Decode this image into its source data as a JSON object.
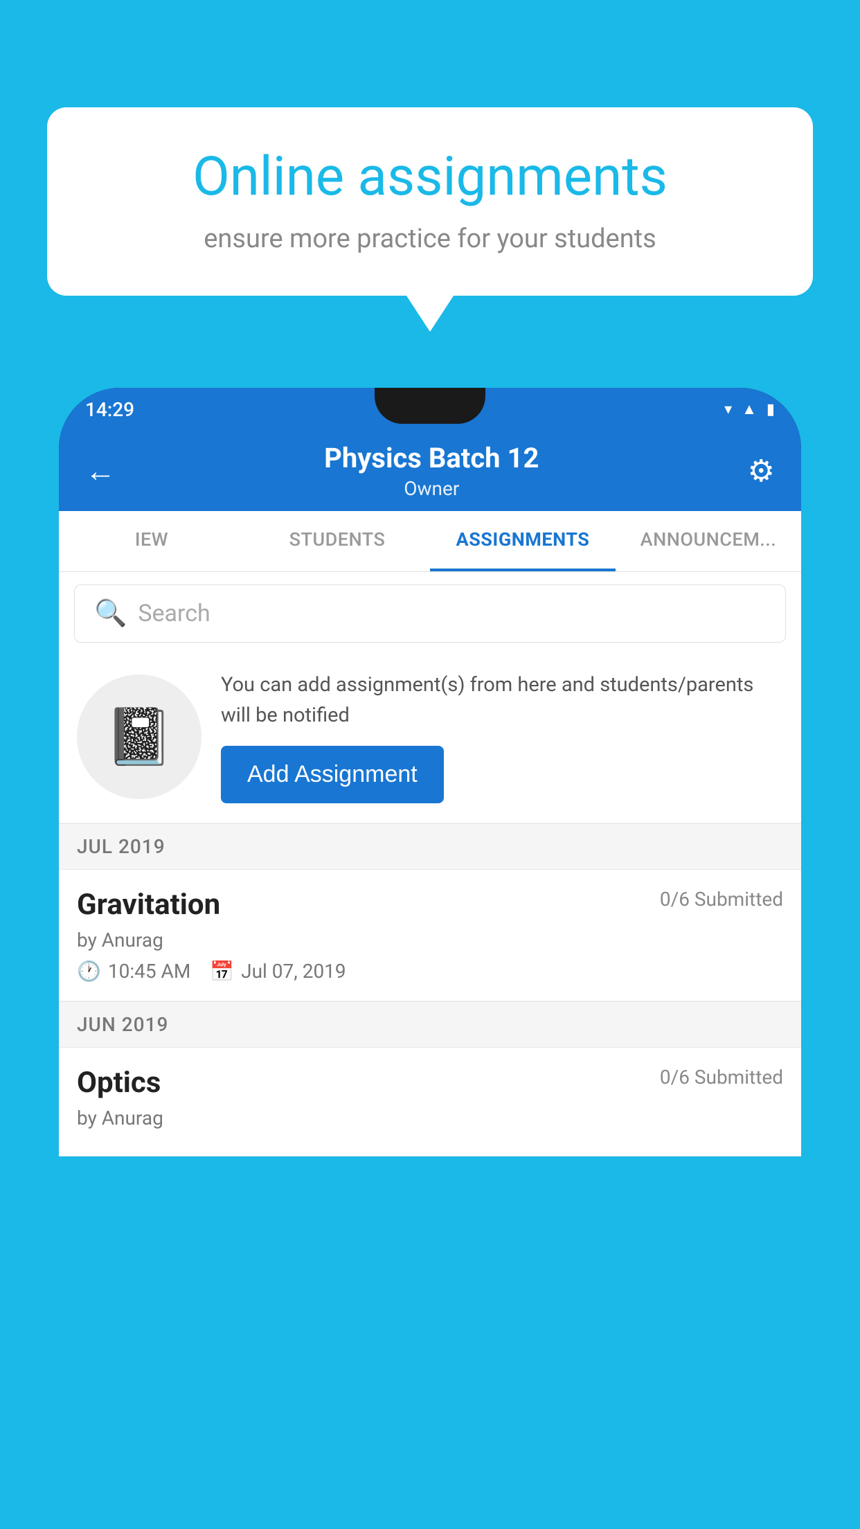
{
  "background": {
    "color": "#1ab9e8"
  },
  "speech_bubble": {
    "title": "Online assignments",
    "subtitle": "ensure more practice for your students"
  },
  "status_bar": {
    "time": "14:29",
    "wifi_icon": "wifi",
    "signal_icon": "signal",
    "battery_icon": "battery"
  },
  "app_bar": {
    "title": "Physics Batch 12",
    "subtitle": "Owner",
    "back_label": "←",
    "settings_label": "⚙"
  },
  "tabs": [
    {
      "label": "IEW",
      "active": false
    },
    {
      "label": "STUDENTS",
      "active": false
    },
    {
      "label": "ASSIGNMENTS",
      "active": true
    },
    {
      "label": "ANNOUNCEM...",
      "active": false
    }
  ],
  "search": {
    "placeholder": "Search"
  },
  "promo": {
    "description": "You can add assignment(s) from here and students/parents will be notified",
    "button_label": "Add Assignment"
  },
  "sections": [
    {
      "label": "JUL 2019",
      "assignments": [
        {
          "name": "Gravitation",
          "submitted": "0/6 Submitted",
          "author": "by Anurag",
          "time": "10:45 AM",
          "date": "Jul 07, 2019"
        }
      ]
    },
    {
      "label": "JUN 2019",
      "assignments": [
        {
          "name": "Optics",
          "submitted": "0/6 Submitted",
          "author": "by Anurag",
          "time": "",
          "date": ""
        }
      ]
    }
  ]
}
